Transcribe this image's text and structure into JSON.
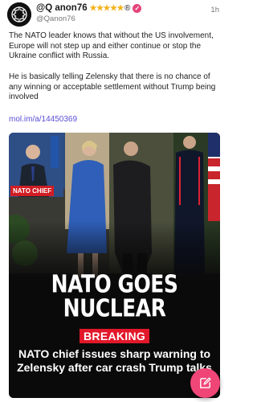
{
  "post": {
    "author": {
      "name": "@Q anon76",
      "stars": "★★★★★",
      "registered_mark": "®",
      "verified_mark": "✓",
      "handle": "@Qanon76",
      "avatar_icon": "q-avatar-icon"
    },
    "timestamp": "1h",
    "paragraphs": [
      "The NATO leader knows that without the US involvement, Europe will not step up and either continue or stop the Ukraine conflict with Russia.",
      "He is basically telling Zelensky that there is no chance of any winning or acceptable settlement without Trump being involved"
    ],
    "link": "mol.im/a/14450369",
    "media": {
      "inset_label": "NATO CHIEF",
      "headline_line1": "NATO GOES",
      "headline_line2": "NUCLEAR",
      "badge": "BREAKING",
      "caption": "NATO chief issues sharp warning to Zelensky after car crash Trump talks"
    }
  },
  "compose_button": {
    "icon": "compose-pencil-icon"
  },
  "colors": {
    "accent_pink": "#ef4577",
    "star_gold": "#f2b21a",
    "link_purple": "#5b4fd6",
    "breaking_red": "#e2182a"
  }
}
